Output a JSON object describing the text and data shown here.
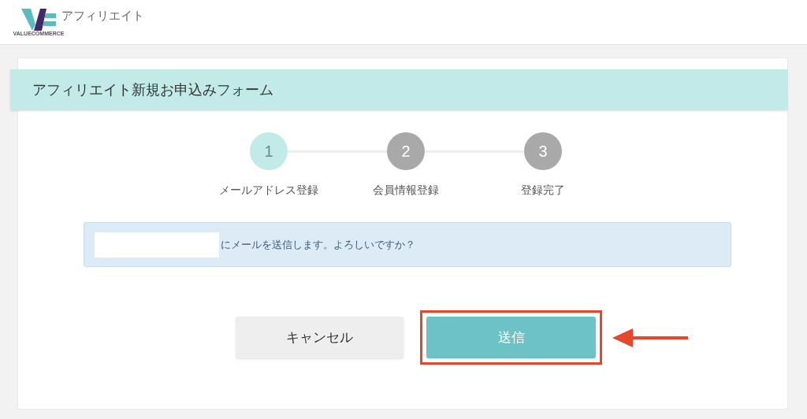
{
  "header": {
    "logo_text": "VALUECOMMERCE",
    "title": "アフィリエイト"
  },
  "form": {
    "title": "アフィリエイト新規お申込みフォーム",
    "steps": [
      {
        "number": "1",
        "label": "メールアドレス登録",
        "selected": true
      },
      {
        "number": "2",
        "label": "会員情報登録",
        "selected": false
      },
      {
        "number": "3",
        "label": "登録完了",
        "selected": false
      }
    ],
    "message": "にメールを送信します。よろしいですか？",
    "buttons": [
      {
        "kind": "cancel",
        "label": "キャンセル",
        "highlighted": false
      },
      {
        "kind": "submit",
        "label": "送信",
        "highlighted": true
      }
    ]
  }
}
